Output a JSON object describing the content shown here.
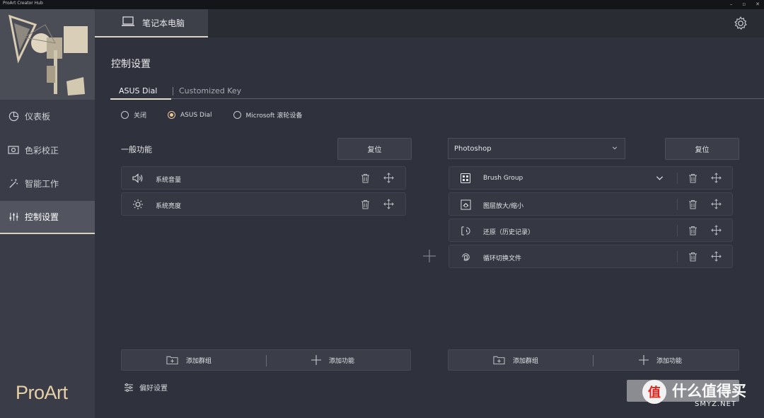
{
  "window": {
    "title": "ProArt Creator Hub"
  },
  "sidebar": {
    "items": [
      {
        "label": "仪表板",
        "icon": "pie-chart-icon"
      },
      {
        "label": "色彩校正",
        "icon": "monitor-calibration-icon"
      },
      {
        "label": "智能工作",
        "icon": "magic-wand-icon"
      },
      {
        "label": "控制设置",
        "icon": "sliders-icon"
      }
    ],
    "logo": "ProArt"
  },
  "topbar": {
    "device_tab": "笔记本电脑"
  },
  "page": {
    "title": "控制设置",
    "tabs": [
      "ASUS Dial",
      "Customized Key"
    ],
    "active_tab": "ASUS Dial"
  },
  "mode": {
    "options": [
      "关闭",
      "ASUS Dial",
      "Microsoft 滚轮设备"
    ],
    "selected": "ASUS Dial"
  },
  "general": {
    "title": "一般功能",
    "reset_label": "复位",
    "items": [
      {
        "label": "系统音量",
        "icon": "speaker-icon"
      },
      {
        "label": "系统亮度",
        "icon": "sun-icon"
      }
    ],
    "add_group_label": "添加群组",
    "add_function_label": "添加功能"
  },
  "app": {
    "selected": "Photoshop",
    "reset_label": "复位",
    "items": [
      {
        "label": "Brush Group",
        "icon": "grid-icon",
        "expandable": true
      },
      {
        "label": "图层放大/缩小",
        "icon": "zoom-frame-icon"
      },
      {
        "label": "还原（历史记录）",
        "icon": "undo-history-icon"
      },
      {
        "label": "循环切换文件",
        "icon": "cycle-files-icon"
      }
    ],
    "add_group_label": "添加群组",
    "add_function_label": "添加功能"
  },
  "footer": {
    "preferences_label": "偏好设置"
  },
  "watermark": {
    "badge": "值",
    "text": "什么值得买",
    "sub": "SMYZ.NET"
  },
  "colors": {
    "accent": "#e8c79b",
    "background": "#2f323c",
    "sidebar": "#3a3d47"
  }
}
